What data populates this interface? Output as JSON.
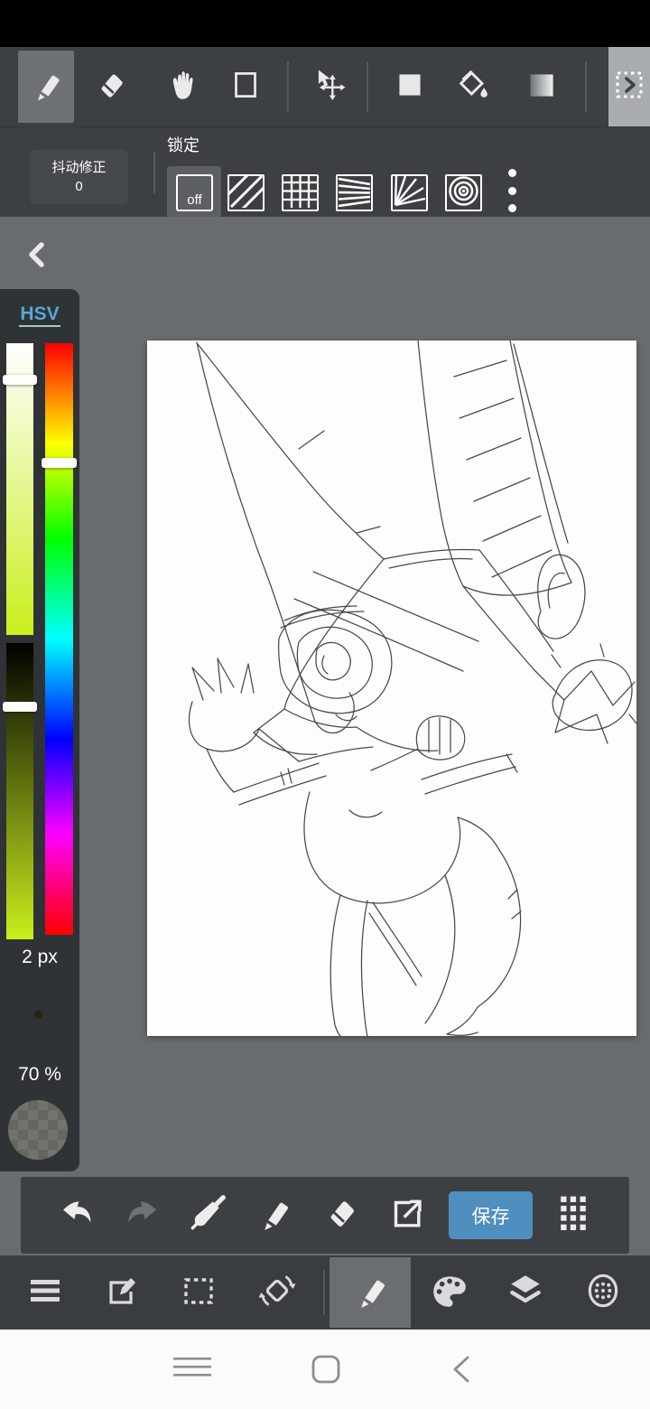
{
  "toolbar": {
    "tools": [
      "pen",
      "eraser",
      "hand",
      "rectangle",
      "transform-move",
      "color-swatch",
      "fill-bucket",
      "gradient",
      "expand-tools"
    ],
    "selected_tool": "pen"
  },
  "correction": {
    "label": "抖动修正",
    "value": "0"
  },
  "lock": {
    "label": "锁定",
    "off_label": "off",
    "selected": "off",
    "modes": [
      "off",
      "diagonal-stripes",
      "grid",
      "converging-lines",
      "radial-lines",
      "concentric-circles",
      "more"
    ]
  },
  "color_panel": {
    "mode_label": "HSV",
    "brush_size_label": "2 px",
    "opacity_label": "70 %"
  },
  "quick_bar": {
    "buttons": [
      "undo",
      "redo",
      "eyedropper",
      "pen",
      "eraser",
      "export",
      "save",
      "grid"
    ],
    "save_label": "保存"
  },
  "nav_bar": {
    "items": [
      "menu",
      "edit",
      "select",
      "rotate-canvas",
      "pen",
      "palette",
      "layers",
      "material-sphere"
    ],
    "selected": "pen"
  },
  "android_nav": {
    "buttons": [
      "recent-apps",
      "home",
      "back"
    ]
  },
  "colors": {
    "accent_blue": "#4e8fbf",
    "link_blue": "#5aa7d0",
    "toolbar_bg": "#3d4042",
    "workspace_bg": "#686c6f",
    "panel_bg": "#2f3336",
    "canvas_bg": "#fdfdfd",
    "current_color": "#23260f"
  }
}
